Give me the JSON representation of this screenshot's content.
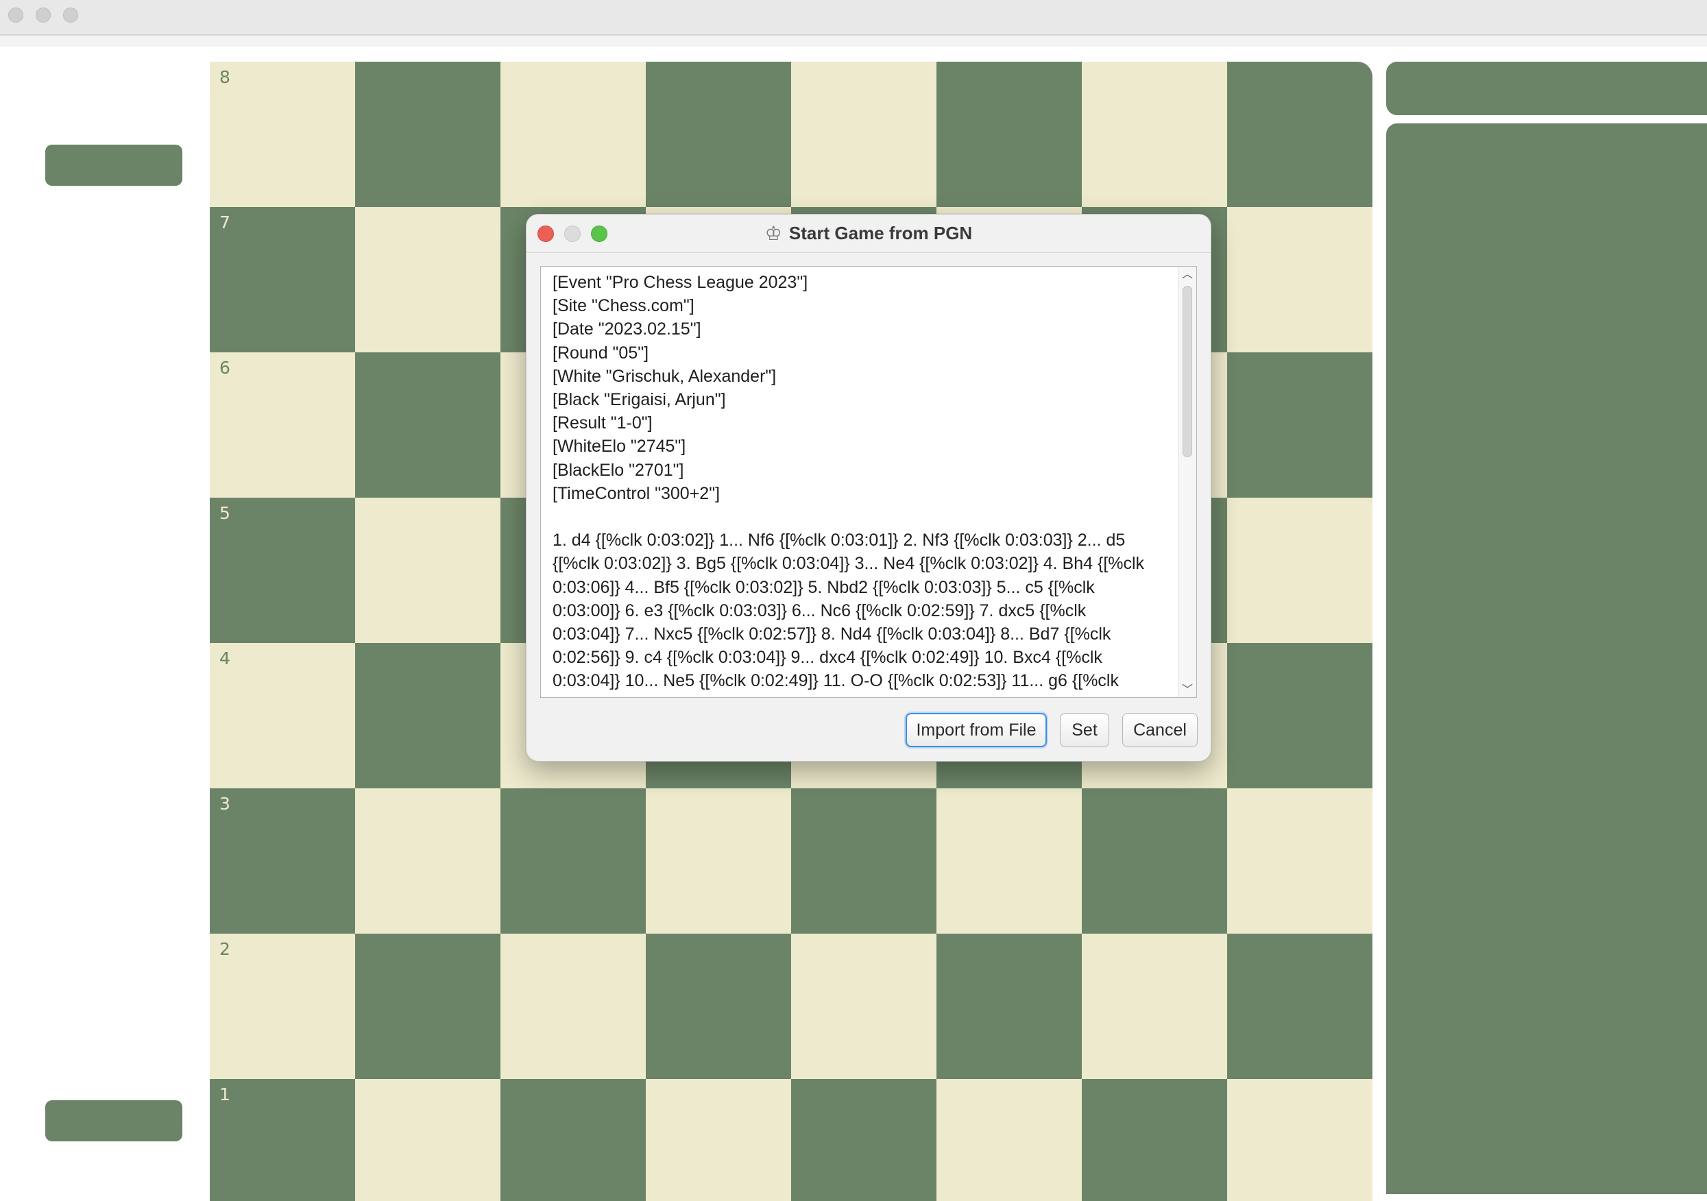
{
  "dialog": {
    "title": "Start Game from PGN",
    "title_icon": "chess-king-icon",
    "pgn_text": "[Event \"Pro Chess League 2023\"]\n[Site \"Chess.com\"]\n[Date \"2023.02.15\"]\n[Round \"05\"]\n[White \"Grischuk, Alexander\"]\n[Black \"Erigaisi, Arjun\"]\n[Result \"1-0\"]\n[WhiteElo \"2745\"]\n[BlackElo \"2701\"]\n[TimeControl \"300+2\"]\n\n1. d4 {[%clk 0:03:02]} 1... Nf6 {[%clk 0:03:01]} 2. Nf3 {[%clk 0:03:03]} 2... d5\n{[%clk 0:03:02]} 3. Bg5 {[%clk 0:03:04]} 3... Ne4 {[%clk 0:03:02]} 4. Bh4 {[%clk\n0:03:06]} 4... Bf5 {[%clk 0:03:02]} 5. Nbd2 {[%clk 0:03:03]} 5... c5 {[%clk\n0:03:00]} 6. e3 {[%clk 0:03:03]} 6... Nc6 {[%clk 0:02:59]} 7. dxc5 {[%clk\n0:03:04]} 7... Nxc5 {[%clk 0:02:57]} 8. Nd4 {[%clk 0:03:04]} 8... Bd7 {[%clk\n0:02:56]} 9. c4 {[%clk 0:03:04]} 9... dxc4 {[%clk 0:02:49]} 10. Bxc4 {[%clk\n0:03:04]} 10... Ne5 {[%clk 0:02:49]} 11. O-O {[%clk 0:02:53]} 11... g6 {[%clk",
    "buttons": {
      "import": "Import from File",
      "set": "Set",
      "cancel": "Cancel"
    }
  },
  "board": {
    "ranks": [
      "8",
      "7",
      "6",
      "5",
      "4",
      "3",
      "2",
      "1"
    ],
    "light_color": "#eeeacd",
    "dark_color": "#6b8467"
  },
  "colors": {
    "accent_green": "#6b8467",
    "focus_blue": "#3b8ee3",
    "close_red": "#ec5f57",
    "zoom_green": "#5ac44a"
  }
}
